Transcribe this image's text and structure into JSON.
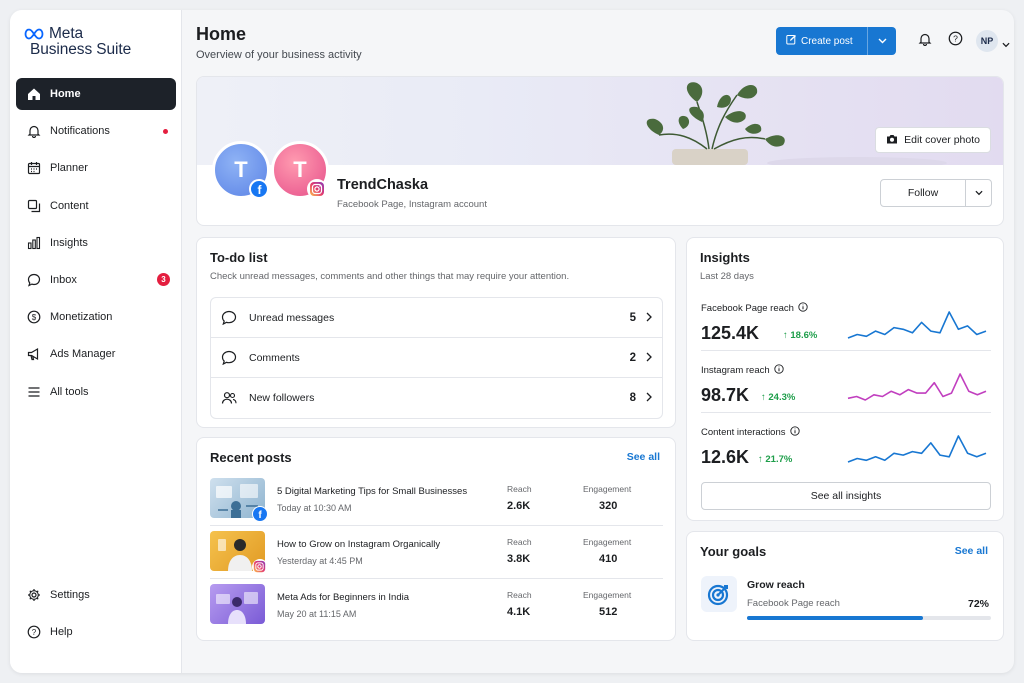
{
  "brand": {
    "line1": "Meta",
    "line2": "Business Suite",
    "logo_icon": "meta-infinity-icon"
  },
  "sidebar": {
    "items": [
      {
        "label": "Home",
        "icon": "home-icon",
        "active": true
      },
      {
        "label": "Notifications",
        "icon": "bell-icon",
        "dot": true
      },
      {
        "label": "Planner",
        "icon": "calendar-icon"
      },
      {
        "label": "Content",
        "icon": "content-icon"
      },
      {
        "label": "Insights",
        "icon": "bar-chart-icon"
      },
      {
        "label": "Inbox",
        "icon": "chat-icon",
        "badge": "3"
      },
      {
        "label": "Monetization",
        "icon": "dollar-icon"
      },
      {
        "label": "Ads Manager",
        "icon": "megaphone-icon"
      },
      {
        "label": "All tools",
        "icon": "menu-icon"
      }
    ],
    "bottom": [
      {
        "label": "Settings",
        "icon": "gear-icon"
      },
      {
        "label": "Help",
        "icon": "help-icon"
      }
    ]
  },
  "header": {
    "title": "Home",
    "subtitle": "Overview of your business activity",
    "create_label": "Create post",
    "avatar_initials": "NP"
  },
  "profile": {
    "name": "TrendChaska",
    "subtitle": "Facebook Page, Instagram account",
    "initial_fb": "T",
    "initial_ig": "T",
    "edit_cover_label": "Edit cover photo",
    "follow_label": "Follow"
  },
  "todo": {
    "title": "To-do list",
    "subtitle": "Check unread messages, comments and other things that may require your attention.",
    "items": [
      {
        "label": "Unread messages",
        "count": "5",
        "icon": "message-icon"
      },
      {
        "label": "Comments",
        "count": "2",
        "icon": "comment-icon"
      },
      {
        "label": "New followers",
        "count": "8",
        "icon": "people-icon"
      }
    ]
  },
  "recent_posts": {
    "title": "Recent posts",
    "see_all": "See all",
    "reach_label": "Reach",
    "engagement_label": "Engagement",
    "posts": [
      {
        "title": "5 Digital Marketing Tips for Small Businesses",
        "time": "Today at 10:30 AM",
        "reach": "2.6K",
        "engagement": "320",
        "platform": "facebook"
      },
      {
        "title": "How to Grow on Instagram Organically",
        "time": "Yesterday at 4:45 PM",
        "reach": "3.8K",
        "engagement": "410",
        "platform": "instagram"
      },
      {
        "title": "Meta Ads for Beginners in India",
        "time": "May 20 at 11:15 AM",
        "reach": "4.1K",
        "engagement": "512",
        "platform": "none"
      }
    ]
  },
  "insights": {
    "title": "Insights",
    "period": "Last 28 days",
    "metrics": [
      {
        "label": "Facebook Page reach",
        "value": "125.4K",
        "delta": "↑ 18.6%",
        "color": "#1877d2",
        "spark": [
          4,
          6,
          5,
          8,
          6,
          10,
          9,
          7,
          13,
          8,
          7,
          19,
          9,
          11,
          6,
          8
        ]
      },
      {
        "label": "Instagram reach",
        "value": "98.7K",
        "delta": "↑ 24.3%",
        "color": "#c13fbf",
        "spark": [
          5,
          6,
          4,
          7,
          6,
          9,
          7,
          10,
          8,
          8,
          14,
          6,
          8,
          19,
          9,
          7,
          9
        ]
      },
      {
        "label": "Content interactions",
        "value": "12.6K",
        "delta": "↑ 21.7%",
        "color": "#1877d2",
        "spark": [
          4,
          6,
          5,
          7,
          5,
          9,
          8,
          10,
          9,
          15,
          8,
          7,
          19,
          9,
          7,
          9
        ]
      }
    ],
    "see_all_label": "See all insights"
  },
  "goals": {
    "title": "Your goals",
    "see_all": "See all",
    "goal_name": "Grow reach",
    "goal_sub": "Facebook Page reach",
    "goal_pct_label": "72%",
    "goal_progress": 0.72
  },
  "colors": {
    "accent": "#1877d2",
    "sidebar_active": "#1d2229",
    "badge": "#e41e3f",
    "positive": "#1e9e4a"
  }
}
